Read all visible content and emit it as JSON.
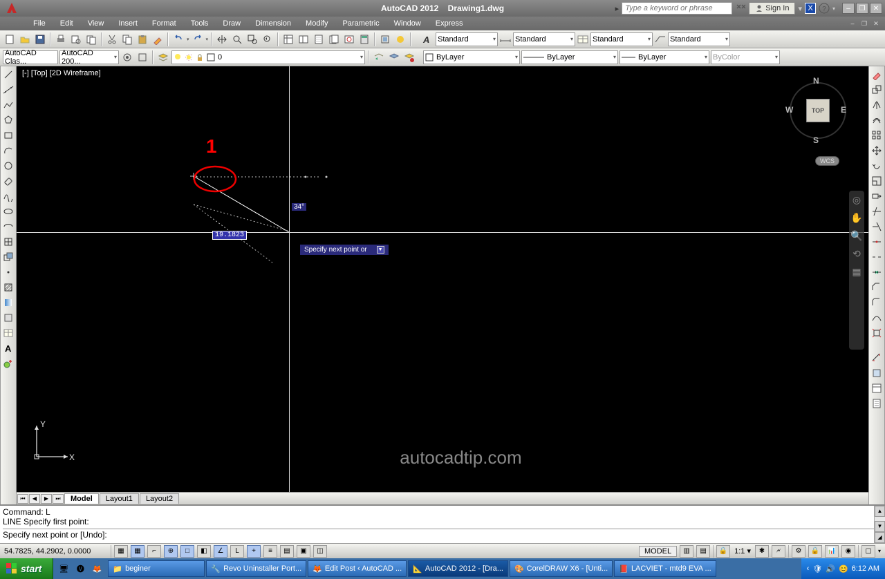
{
  "title": {
    "app": "AutoCAD 2012",
    "doc": "Drawing1.dwg"
  },
  "search": {
    "placeholder": "Type a keyword or phrase"
  },
  "sign_in": "Sign In",
  "menu": [
    "File",
    "Edit",
    "View",
    "Insert",
    "Format",
    "Tools",
    "Draw",
    "Dimension",
    "Modify",
    "Parametric",
    "Window",
    "Express"
  ],
  "workspace": {
    "combo1": "AutoCAD Clas...",
    "combo2": "AutoCAD 200..."
  },
  "layer": {
    "name": "0"
  },
  "styles": {
    "text": "Standard",
    "dim": "Standard",
    "table": "Standard",
    "mleader": "Standard"
  },
  "props": {
    "bylayer": "ByLayer",
    "color": "ByLayer",
    "ltype": "ByLayer",
    "bycolor": "ByColor"
  },
  "view_label": "[-] [Top] [2D Wireframe]",
  "viewcube": {
    "top": "TOP",
    "n": "N",
    "s": "S",
    "e": "E",
    "w": "W",
    "wcs": "WCS"
  },
  "watermark": "autocadtip.com",
  "dynamic": {
    "dist": "19.1823",
    "angle": "34°",
    "prompt": "Specify next point or"
  },
  "annotation": {
    "num": "1"
  },
  "tabs": {
    "model": "Model",
    "l1": "Layout1",
    "l2": "Layout2"
  },
  "cmd": {
    "l1": "Command: L",
    "l2": "LINE Specify first point:",
    "l3": "Specify next point or [Undo]:"
  },
  "status": {
    "coords": "54.7825, 44.2902, 0.0000",
    "model": "MODEL",
    "scale": "1:1"
  },
  "taskbar": {
    "start": "start",
    "items": [
      "beginer",
      "Revo Uninstaller Port...",
      "Edit Post ‹ AutoCAD ...",
      "AutoCAD 2012 - [Dra...",
      "CorelDRAW X6 - [Unti...",
      "LACVIET - mtd9 EVA ..."
    ],
    "clock": "6:12 AM"
  }
}
